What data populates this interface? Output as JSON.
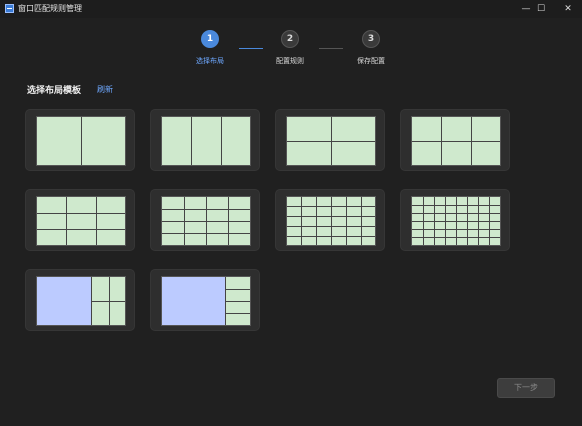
{
  "window": {
    "title": "窗口匹配规则管理",
    "minimize_glyph": "—",
    "maximize_glyph": "☐",
    "close_glyph": "✕"
  },
  "steps": [
    {
      "number": "1",
      "label": "选择布局",
      "state": "active"
    },
    {
      "number": "2",
      "label": "配置规则",
      "state": "inactive"
    },
    {
      "number": "3",
      "label": "保存配置",
      "state": "inactive"
    }
  ],
  "section": {
    "title": "选择布局模板",
    "refresh_label": "刷新"
  },
  "templates": [
    {
      "layout": "2x1"
    },
    {
      "layout": "3x1"
    },
    {
      "layout": "2x2"
    },
    {
      "layout": "3x2"
    },
    {
      "layout": "3x3"
    },
    {
      "layout": "4x4"
    },
    {
      "layout": "6x5"
    },
    {
      "layout": "8x6"
    },
    {
      "layout": "main-plus-2x3"
    },
    {
      "layout": "main-plus-1x4"
    }
  ],
  "footer": {
    "next_label": "下一步"
  },
  "colors": {
    "accent": "#4a89dc",
    "cell_green": "#cfe9cd",
    "main_blue": "#bccbff",
    "background": "#202020"
  }
}
